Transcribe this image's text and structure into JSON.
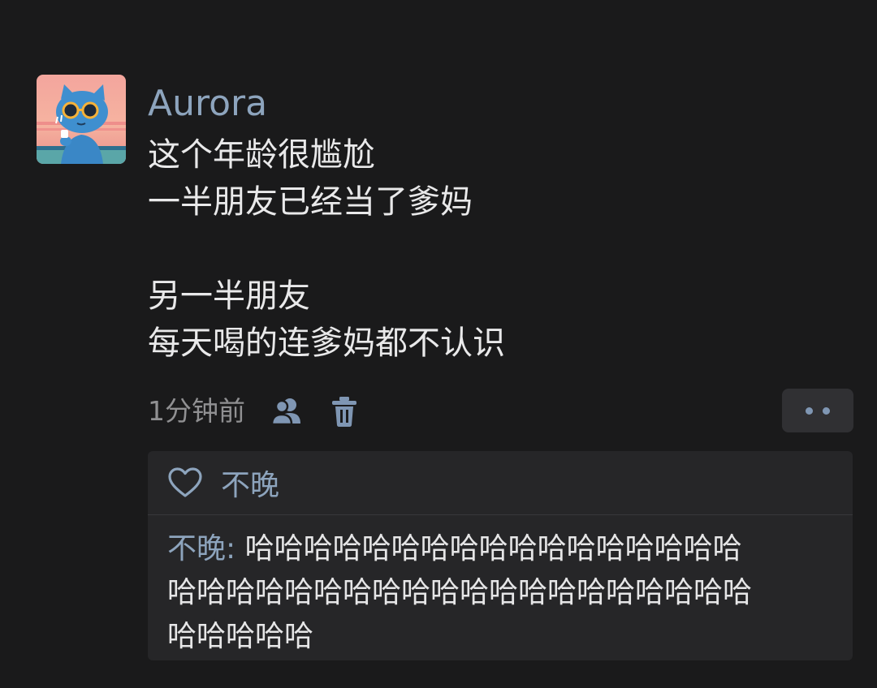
{
  "post": {
    "username": "Aurora",
    "content_lines": [
      "这个年龄很尴尬",
      "一半朋友已经当了爹妈",
      "",
      "另一半朋友",
      "每天喝的连爹妈都不认识"
    ],
    "timestamp": "1分钟前"
  },
  "likes": {
    "names": "不晚"
  },
  "comment": {
    "author": "不晚",
    "separator": ": ",
    "text_lines": [
      "哈哈哈哈哈哈哈哈哈哈哈哈哈哈哈哈哈",
      "哈哈哈哈哈哈哈哈哈哈哈哈哈哈哈哈哈哈哈哈",
      "哈哈哈哈哈"
    ]
  },
  "icons": {
    "friends": "friends-icon",
    "delete": "trash-icon",
    "more": "more-dots-icon",
    "like": "heart-icon"
  },
  "colors": {
    "background": "#1a1a1b",
    "accent_name": "#8da4bd",
    "text": "#e9e9ea",
    "panel": "#262628"
  }
}
